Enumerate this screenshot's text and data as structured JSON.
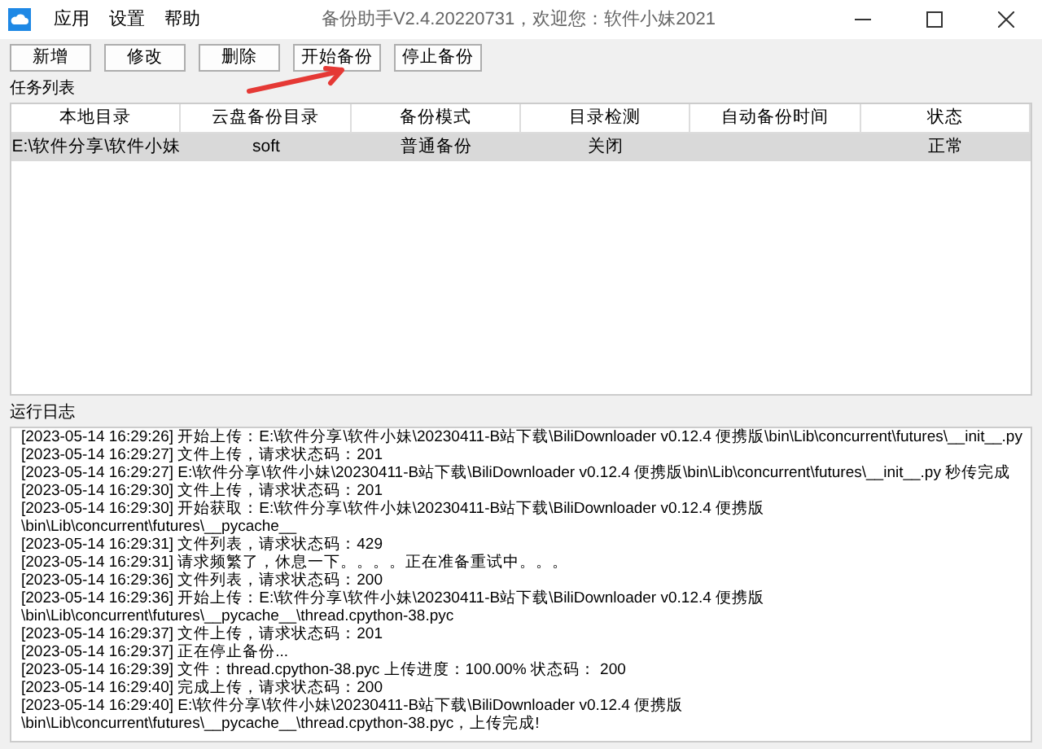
{
  "window": {
    "title": "备份助手V2.4.20220731，欢迎您：软件小妹2021",
    "menu": [
      "应用",
      "设置",
      "帮助"
    ]
  },
  "toolbar": [
    "新增",
    "修改",
    "删除",
    "开始备份",
    "停止备份"
  ],
  "task_list": {
    "label": "任务列表",
    "columns": [
      "本地目录",
      "云盘备份目录",
      "备份模式",
      "目录检测",
      "自动备份时间",
      "状态"
    ],
    "rows": [
      {
        "selected": true,
        "cells": [
          "E:\\软件分享\\软件小妹",
          "soft",
          "普通备份",
          "关闭",
          "",
          "正常"
        ]
      }
    ]
  },
  "log": {
    "label": "运行日志",
    "lines": [
      "[2023-05-14 16:29:26] 开始上传：E:\\软件分享\\软件小妹\\20230411-B站下载\\BiliDownloader v0.12.4 便携版\\bin\\Lib\\concurrent\\futures\\__init__.py",
      "[2023-05-14 16:29:27] 文件上传，请求状态码：201",
      "[2023-05-14 16:29:27] E:\\软件分享\\软件小妹\\20230411-B站下载\\BiliDownloader v0.12.4 便携版\\bin\\Lib\\concurrent\\futures\\__init__.py 秒传完成",
      "[2023-05-14 16:29:30] 文件上传，请求状态码：201",
      "[2023-05-14 16:29:30] 开始获取：E:\\软件分享\\软件小妹\\20230411-B站下载\\BiliDownloader v0.12.4 便携版\\bin\\Lib\\concurrent\\futures\\__pycache__",
      "[2023-05-14 16:29:31] 文件列表，请求状态码：429",
      "[2023-05-14 16:29:31] 请求频繁了，休息一下。。。。正在准备重试中。。。",
      "[2023-05-14 16:29:36] 文件列表，请求状态码：200",
      "[2023-05-14 16:29:36] 开始上传：E:\\软件分享\\软件小妹\\20230411-B站下载\\BiliDownloader v0.12.4 便携版\\bin\\Lib\\concurrent\\futures\\__pycache__\\thread.cpython-38.pyc",
      "[2023-05-14 16:29:37] 文件上传，请求状态码：201",
      "[2023-05-14 16:29:37] 正在停止备份...",
      "[2023-05-14 16:29:39] 文件：thread.cpython-38.pyc 上传进度：100.00% 状态码： 200",
      "[2023-05-14 16:29:40] 完成上传，请求状态码：200",
      "[2023-05-14 16:29:40] E:\\软件分享\\软件小妹\\20230411-B站下载\\BiliDownloader v0.12.4 便携版\\bin\\Lib\\concurrent\\futures\\__pycache__\\thread.cpython-38.pyc，上传完成!"
    ]
  }
}
